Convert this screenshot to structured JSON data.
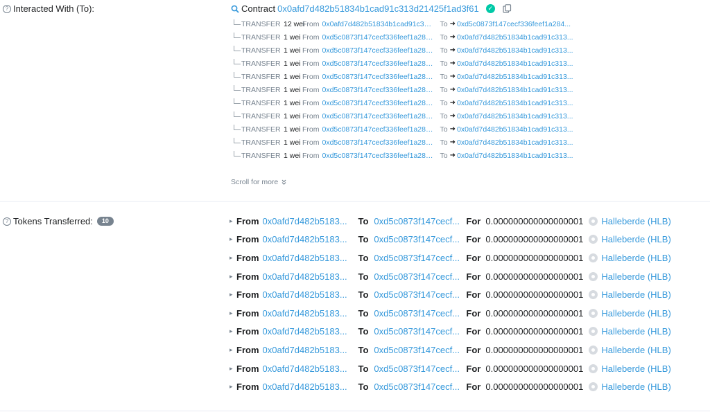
{
  "interacted": {
    "label": "Interacted With (To):",
    "contract_prefix": "Contract",
    "contract_address": "0x0afd7d482b51834b1cad91c313d21425f1ad3f61"
  },
  "internal_txs": [
    {
      "type": "TRANSFER",
      "amount": "12 wei",
      "from_label": "From",
      "from": "0x0afd7d482b51834b1cad91c313...",
      "to_label": "To",
      "to": "0xd5c0873f147cecf336feef1a284..."
    },
    {
      "type": "TRANSFER",
      "amount": "1 wei",
      "from_label": "From",
      "from": "0xd5c0873f147cecf336feef1a284...",
      "to_label": "To",
      "to": "0x0afd7d482b51834b1cad91c313..."
    },
    {
      "type": "TRANSFER",
      "amount": "1 wei",
      "from_label": "From",
      "from": "0xd5c0873f147cecf336feef1a284...",
      "to_label": "To",
      "to": "0x0afd7d482b51834b1cad91c313..."
    },
    {
      "type": "TRANSFER",
      "amount": "1 wei",
      "from_label": "From",
      "from": "0xd5c0873f147cecf336feef1a284...",
      "to_label": "To",
      "to": "0x0afd7d482b51834b1cad91c313..."
    },
    {
      "type": "TRANSFER",
      "amount": "1 wei",
      "from_label": "From",
      "from": "0xd5c0873f147cecf336feef1a284...",
      "to_label": "To",
      "to": "0x0afd7d482b51834b1cad91c313..."
    },
    {
      "type": "TRANSFER",
      "amount": "1 wei",
      "from_label": "From",
      "from": "0xd5c0873f147cecf336feef1a284...",
      "to_label": "To",
      "to": "0x0afd7d482b51834b1cad91c313..."
    },
    {
      "type": "TRANSFER",
      "amount": "1 wei",
      "from_label": "From",
      "from": "0xd5c0873f147cecf336feef1a284...",
      "to_label": "To",
      "to": "0x0afd7d482b51834b1cad91c313..."
    },
    {
      "type": "TRANSFER",
      "amount": "1 wei",
      "from_label": "From",
      "from": "0xd5c0873f147cecf336feef1a284...",
      "to_label": "To",
      "to": "0x0afd7d482b51834b1cad91c313..."
    },
    {
      "type": "TRANSFER",
      "amount": "1 wei",
      "from_label": "From",
      "from": "0xd5c0873f147cecf336feef1a284...",
      "to_label": "To",
      "to": "0x0afd7d482b51834b1cad91c313..."
    },
    {
      "type": "TRANSFER",
      "amount": "1 wei",
      "from_label": "From",
      "from": "0xd5c0873f147cecf336feef1a284...",
      "to_label": "To",
      "to": "0x0afd7d482b51834b1cad91c313..."
    },
    {
      "type": "TRANSFER",
      "amount": "1 wei",
      "from_label": "From",
      "from": "0xd5c0873f147cecf336feef1a284...",
      "to_label": "To",
      "to": "0x0afd7d482b51834b1cad91c313..."
    }
  ],
  "scroll_more": "Scroll for more",
  "tokens": {
    "label": "Tokens Transferred:",
    "count": "10",
    "rows": [
      {
        "from_k": "From",
        "from": "0x0afd7d482b5183...",
        "to_k": "To",
        "to": "0xd5c0873f147cecf...",
        "for_k": "For",
        "value": "0.000000000000000001",
        "token": "Halleberde (HLB)"
      },
      {
        "from_k": "From",
        "from": "0x0afd7d482b5183...",
        "to_k": "To",
        "to": "0xd5c0873f147cecf...",
        "for_k": "For",
        "value": "0.000000000000000001",
        "token": "Halleberde (HLB)"
      },
      {
        "from_k": "From",
        "from": "0x0afd7d482b5183...",
        "to_k": "To",
        "to": "0xd5c0873f147cecf...",
        "for_k": "For",
        "value": "0.000000000000000001",
        "token": "Halleberde (HLB)"
      },
      {
        "from_k": "From",
        "from": "0x0afd7d482b5183...",
        "to_k": "To",
        "to": "0xd5c0873f147cecf...",
        "for_k": "For",
        "value": "0.000000000000000001",
        "token": "Halleberde (HLB)"
      },
      {
        "from_k": "From",
        "from": "0x0afd7d482b5183...",
        "to_k": "To",
        "to": "0xd5c0873f147cecf...",
        "for_k": "For",
        "value": "0.000000000000000001",
        "token": "Halleberde (HLB)"
      },
      {
        "from_k": "From",
        "from": "0x0afd7d482b5183...",
        "to_k": "To",
        "to": "0xd5c0873f147cecf...",
        "for_k": "For",
        "value": "0.000000000000000001",
        "token": "Halleberde (HLB)"
      },
      {
        "from_k": "From",
        "from": "0x0afd7d482b5183...",
        "to_k": "To",
        "to": "0xd5c0873f147cecf...",
        "for_k": "For",
        "value": "0.000000000000000001",
        "token": "Halleberde (HLB)"
      },
      {
        "from_k": "From",
        "from": "0x0afd7d482b5183...",
        "to_k": "To",
        "to": "0xd5c0873f147cecf...",
        "for_k": "For",
        "value": "0.000000000000000001",
        "token": "Halleberde (HLB)"
      },
      {
        "from_k": "From",
        "from": "0x0afd7d482b5183...",
        "to_k": "To",
        "to": "0xd5c0873f147cecf...",
        "for_k": "For",
        "value": "0.000000000000000001",
        "token": "Halleberde (HLB)"
      },
      {
        "from_k": "From",
        "from": "0x0afd7d482b5183...",
        "to_k": "To",
        "to": "0xd5c0873f147cecf...",
        "for_k": "For",
        "value": "0.000000000000000001",
        "token": "Halleberde (HLB)"
      }
    ]
  },
  "icons": {
    "help": "question-circle-icon",
    "contract": "zoom-icon",
    "verified": "check-circle-icon",
    "copy": "copy-icon",
    "token": "token-logo-icon"
  },
  "colors": {
    "link": "#3498db",
    "muted": "#77838f",
    "verified": "#00c9a7",
    "divider": "#e7eaf3"
  }
}
